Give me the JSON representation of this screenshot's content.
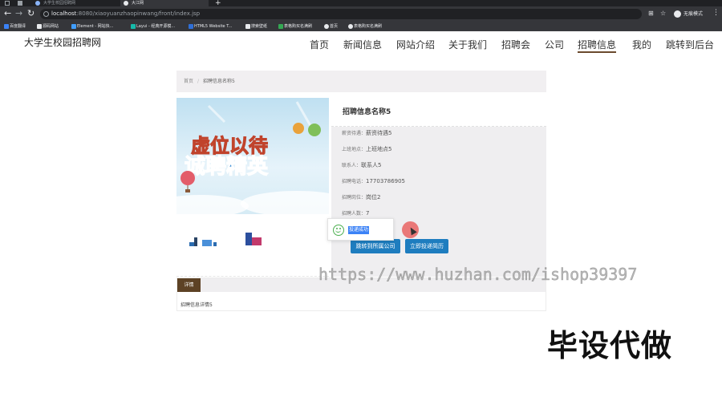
{
  "browser": {
    "tabs": [
      {
        "title": "大学生校园招聘网"
      },
      {
        "title": "大江网"
      }
    ],
    "url_host": "localhost",
    "url_rest": ":8080/xiaoyuanzhaopinwang/front/index.jsp",
    "profile": "无痕模式",
    "bookmarks": [
      {
        "label": "百度翻译",
        "color": "#3b82f6"
      },
      {
        "label": "源码网站",
        "color": "#e8eaed"
      },
      {
        "label": "Element - 网站快...",
        "color": "#409eff"
      },
      {
        "label": "Layui - 经典开源模...",
        "color": "#16baaa"
      },
      {
        "label": "HTML5 Website T...",
        "color": "#2f6fd6"
      },
      {
        "label": "搜索壁纸",
        "color": "#e8eaed"
      },
      {
        "label": "表格购买名满刷",
        "color": "#34a853"
      },
      {
        "label": "首页",
        "color": "#e8eaed"
      },
      {
        "label": "表格购买名满刷",
        "color": "#e8eaed"
      }
    ]
  },
  "site": {
    "title": "大学生校园招聘网",
    "nav": [
      {
        "label": "首页"
      },
      {
        "label": "新闻信息"
      },
      {
        "label": "网站介绍"
      },
      {
        "label": "关于我们"
      },
      {
        "label": "招聘会"
      },
      {
        "label": "公司"
      },
      {
        "label": "招聘信息",
        "active": true
      },
      {
        "label": "我的"
      },
      {
        "label": "跳转到后台"
      }
    ]
  },
  "breadcrumb": {
    "home": "首页",
    "current": "招聘信息名称5"
  },
  "job": {
    "name": "招聘信息名称5",
    "rows": [
      {
        "label": "薪资待遇：",
        "value": "薪资待遇5"
      },
      {
        "label": "上班地点：",
        "value": "上班地点5"
      },
      {
        "label": "联系人：",
        "value": "联系人5"
      },
      {
        "label": "招聘电话：",
        "value": "17703786905"
      },
      {
        "label": "招聘岗位：",
        "value": "岗位2"
      },
      {
        "label": "招聘人数：",
        "value": "7"
      }
    ],
    "banner_text": "虚位以待 诚聘精英",
    "buttons": {
      "company": "跳转到所属公司",
      "apply": "立即投递简历"
    }
  },
  "toast": {
    "message": "投递成功"
  },
  "details": {
    "tab": "详情",
    "text": "招聘信息详情5"
  },
  "overlay": {
    "watermark": "https://www.huzhan.com/ishop39397",
    "promo": "毕设代做"
  }
}
